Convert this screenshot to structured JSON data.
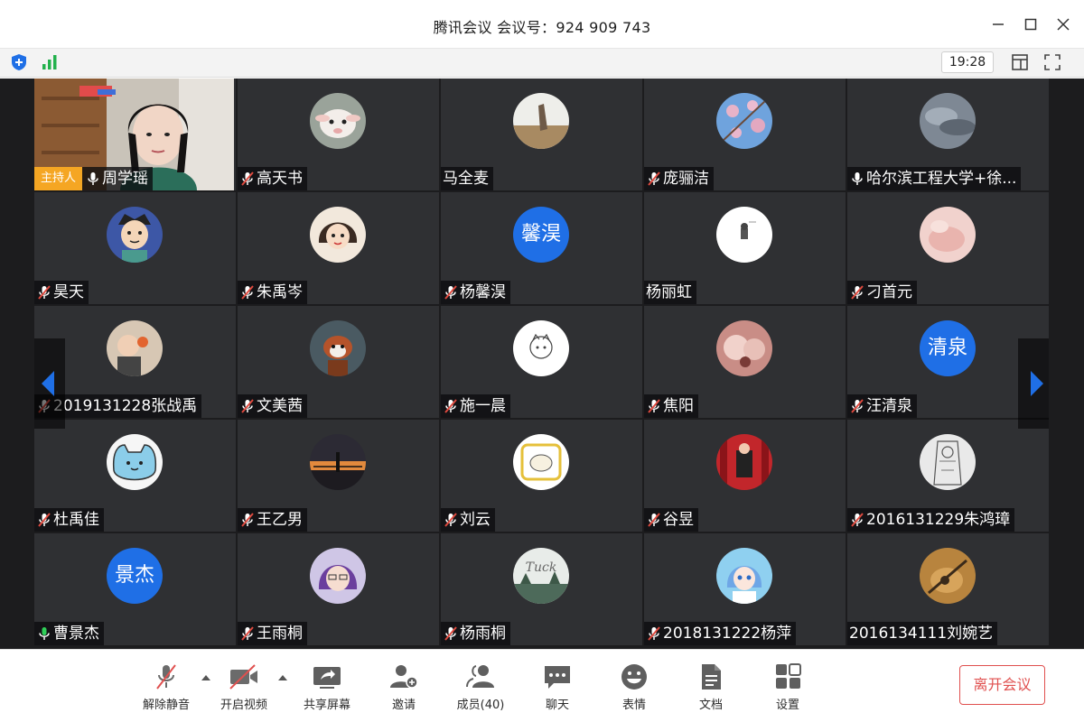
{
  "window": {
    "title": "腾讯会议 会议号：924 909 743"
  },
  "topbar": {
    "time": "19:28"
  },
  "host_label": "主持人",
  "participants": [
    {
      "name": "周学瑶",
      "mic": "on",
      "avatar": "video",
      "host": true
    },
    {
      "name": "高天书",
      "mic": "muted",
      "avatar": "lamb-photo"
    },
    {
      "name": "马全麦",
      "mic": "none",
      "avatar": "field-photo"
    },
    {
      "name": "庞骊洁",
      "mic": "muted",
      "avatar": "blossom-photo"
    },
    {
      "name": "哈尔滨工程大学+徐...",
      "mic": "on",
      "avatar": "cloud-photo"
    },
    {
      "name": "昊天",
      "mic": "muted",
      "avatar": "cartoon-boy"
    },
    {
      "name": "朱禹岑",
      "mic": "muted",
      "avatar": "cartoon-girl"
    },
    {
      "name": "杨馨淏",
      "mic": "muted",
      "avatar": "text",
      "avatar_text": "馨淏"
    },
    {
      "name": "杨丽虹",
      "mic": "none",
      "avatar": "white-doodle"
    },
    {
      "name": "刁首元",
      "mic": "muted",
      "avatar": "pink-photo"
    },
    {
      "name": "2019131228张战禹",
      "mic": "muted",
      "avatar": "child-photo"
    },
    {
      "name": "文美茜",
      "mic": "muted",
      "avatar": "red-panda-photo"
    },
    {
      "name": "施一晨",
      "mic": "muted",
      "avatar": "white-sketch"
    },
    {
      "name": "焦阳",
      "mic": "muted",
      "avatar": "skin-photo"
    },
    {
      "name": "汪清泉",
      "mic": "muted",
      "avatar": "text",
      "avatar_text": "清泉"
    },
    {
      "name": "杜禹佳",
      "mic": "muted",
      "avatar": "blue-cat"
    },
    {
      "name": "王乙男",
      "mic": "muted",
      "avatar": "sunset-photo"
    },
    {
      "name": "刘云",
      "mic": "muted",
      "avatar": "yellow-doodle"
    },
    {
      "name": "谷昱",
      "mic": "muted",
      "avatar": "red-photo"
    },
    {
      "name": "2016131229朱鸿璋",
      "mic": "muted",
      "avatar": "sketch-photo"
    },
    {
      "name": "曹景杰",
      "mic": "on-green",
      "avatar": "text",
      "avatar_text": "景杰"
    },
    {
      "name": "王雨桐",
      "mic": "muted",
      "avatar": "anime-girl"
    },
    {
      "name": "杨雨桐",
      "mic": "muted",
      "avatar": "forest-text"
    },
    {
      "name": "2018131222杨萍",
      "mic": "muted",
      "avatar": "anime-blue"
    },
    {
      "name": "2016134111刘婉艺",
      "mic": "none",
      "avatar": "guitar-photo"
    }
  ],
  "toolbar": {
    "unmute": "解除静音",
    "video": "开启视频",
    "share": "共享屏幕",
    "invite": "邀请",
    "members": "成员(40)",
    "chat": "聊天",
    "emoji": "表情",
    "docs": "文档",
    "settings": "设置",
    "leave": "离开会议"
  },
  "colors": {
    "accent": "#1f6fe6",
    "leave": "#e0504f",
    "host": "#f5a623",
    "tile": "#2f3033"
  }
}
